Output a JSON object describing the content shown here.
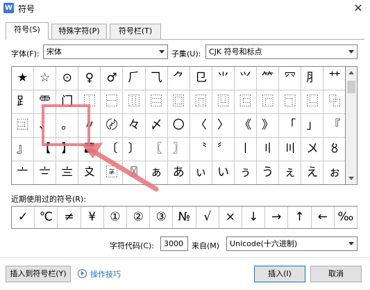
{
  "window": {
    "app_icon_letter": "W",
    "title": "符号",
    "close_glyph": "✕"
  },
  "tabs": [
    {
      "label": "符号(S)",
      "active": true
    },
    {
      "label": "特殊字符(P)",
      "active": false
    },
    {
      "label": "符号栏(T)",
      "active": false
    }
  ],
  "font": {
    "label": "字体(F):",
    "value": "宋体"
  },
  "subset": {
    "label": "子集(U):",
    "value": "CJK 符号和标点"
  },
  "symbol_grid": [
    [
      "★",
      "☆",
      "⊙",
      "♀",
      "♂",
      "⺁",
      "⺄",
      "⺈",
      "⺋",
      "⺌",
      "⺍",
      "⺮",
      "⺳",
      "⺼",
      "⺿"
    ],
    [
      "⻊",
      "⻗",
      "⻔",
      "⿰",
      "⿱",
      "⿲",
      "⿳",
      "⿴",
      "⿵",
      "⿶",
      "⿷",
      "⿸",
      "⿹",
      "⿺",
      "⿻"
    ],
    [
      "⿼",
      "、",
      "。",
      "〃",
      "〄",
      "々",
      "〆",
      "〇",
      "〈",
      "〉",
      "《",
      "》",
      "「",
      "」",
      "『"
    ],
    [
      "』",
      "【",
      "】",
      "〓",
      "〔",
      "〕",
      "〖",
      "〗",
      "〝",
      "〞",
      "〡",
      "〢",
      "〣",
      "〤",
      "〥"
    ],
    [
      "〦",
      "〧",
      "〨",
      "〩",
      "〾",
      "〿",
      "ぁ",
      "あ",
      "ぃ",
      "い",
      "ぅ",
      "う",
      "ぇ",
      "え",
      "ぉ"
    ]
  ],
  "recent": {
    "label": "近期使用过的符号(R):",
    "symbols": [
      "✓",
      "℃",
      "≠",
      "¥",
      "①",
      "②",
      "③",
      "№",
      "√",
      "×",
      "↓",
      "→",
      "↑",
      "←",
      "‰"
    ]
  },
  "char_code": {
    "label": "字符代码(C):",
    "value": "3000"
  },
  "from": {
    "label": "来自(M)",
    "value": "Unicode(十六进制)"
  },
  "buttons": {
    "insert_to_bar": "插入到符号栏(Y)",
    "tips": "操作技巧",
    "insert": "插入(I)",
    "cancel": "取消"
  },
  "annotation_color": "#e8727a"
}
